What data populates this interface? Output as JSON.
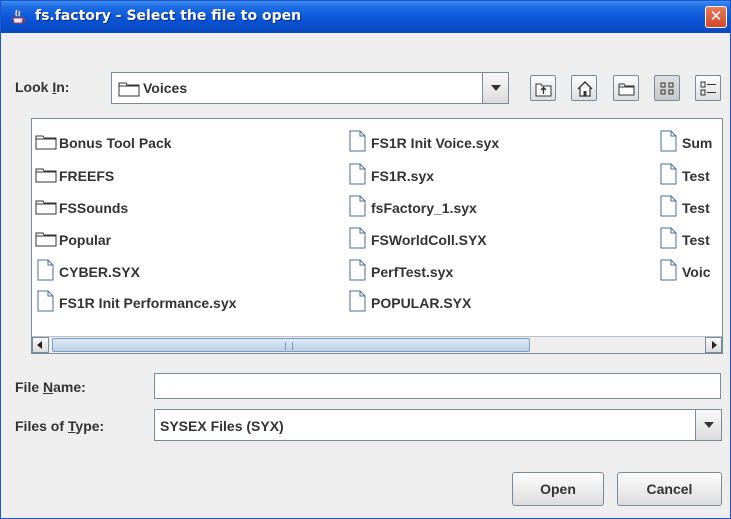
{
  "window": {
    "title": "fs.factory - Select the file to open",
    "close_symbol": "✕"
  },
  "look_in": {
    "label_pre": "Look ",
    "label_mnemonic": "I",
    "label_post": "n:",
    "value": "Voices"
  },
  "toolbar": {
    "icons": [
      "up-one-level-icon",
      "home-icon",
      "new-folder-icon",
      "list-view-icon",
      "details-view-icon"
    ],
    "selected_view": "list-view"
  },
  "files": [
    {
      "name": "Bonus Tool Pack",
      "type": "folder"
    },
    {
      "name": "FREEFS",
      "type": "folder"
    },
    {
      "name": "FSSounds",
      "type": "folder"
    },
    {
      "name": "Popular",
      "type": "folder"
    },
    {
      "name": "CYBER.SYX",
      "type": "file"
    },
    {
      "name": "FS1R Init Performance.syx",
      "type": "file"
    },
    {
      "name": "FS1R Init Voice.syx",
      "type": "file"
    },
    {
      "name": "FS1R.syx",
      "type": "file"
    },
    {
      "name": "fsFactory_1.syx",
      "type": "file"
    },
    {
      "name": "FSWorldColl.SYX",
      "type": "file"
    },
    {
      "name": "PerfTest.syx",
      "type": "file"
    },
    {
      "name": "POPULAR.SYX",
      "type": "file"
    },
    {
      "name": "Sum",
      "type": "file"
    },
    {
      "name": "Test",
      "type": "file"
    },
    {
      "name": "Test",
      "type": "file"
    },
    {
      "name": "Test",
      "type": "file"
    },
    {
      "name": "Voic",
      "type": "file"
    }
  ],
  "file_name": {
    "label_pre": "File ",
    "label_mnemonic": "N",
    "label_post": "ame:",
    "value": ""
  },
  "file_type": {
    "label_pre": "Files of ",
    "label_mnemonic": "T",
    "label_post": "ype:",
    "value": "SYSEX Files (SYX)"
  },
  "buttons": {
    "open": "Open",
    "cancel": "Cancel"
  }
}
